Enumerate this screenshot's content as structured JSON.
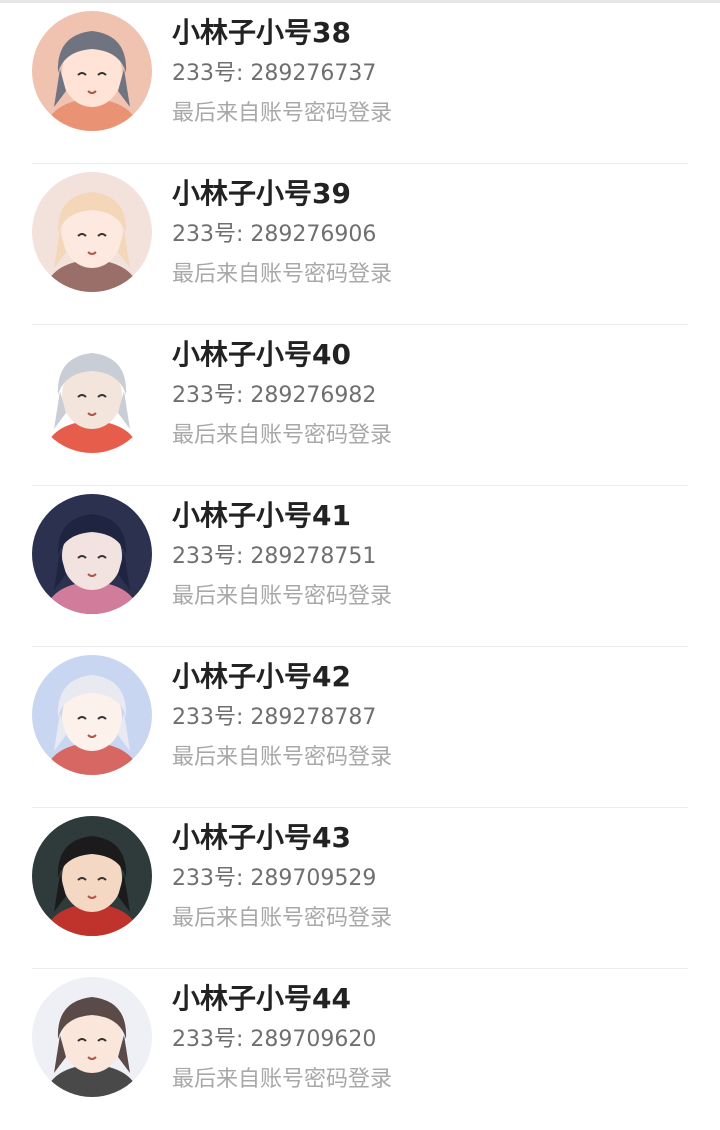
{
  "accounts": [
    {
      "name": "小林子小号38",
      "uid_label": "233号: 289276737",
      "login_source": "最后来自账号密码登录",
      "avatar_icon": "anime-girl-avatar",
      "colors": {
        "bg": "#f0c2b0",
        "hair": "#6f7480",
        "skin": "#ffe3d6",
        "accent": "#e88a6a"
      }
    },
    {
      "name": "小林子小号39",
      "uid_label": "233号: 289276906",
      "login_source": "最后来自账号密码登录",
      "avatar_icon": "anime-boy-avatar",
      "colors": {
        "bg": "#f3e2dc",
        "hair": "#f4d6b8",
        "skin": "#fde9df",
        "accent": "#8a5a56"
      }
    },
    {
      "name": "小林子小号40",
      "uid_label": "233号: 289276982",
      "login_source": "最后来自账号密码登录",
      "avatar_icon": "firefighter-avatar",
      "colors": {
        "bg": "#ffffff",
        "hair": "#c9ced6",
        "skin": "#f3e5dc",
        "accent": "#e2412b"
      }
    },
    {
      "name": "小林子小号41",
      "uid_label": "233号: 289278751",
      "login_source": "最后来自账号密码登录",
      "avatar_icon": "anime-boy-avatar",
      "colors": {
        "bg": "#2c3150",
        "hair": "#1f2540",
        "skin": "#f2e2e0",
        "accent": "#f08aa8"
      }
    },
    {
      "name": "小林子小号42",
      "uid_label": "233号: 289278787",
      "login_source": "最后来自账号密码登录",
      "avatar_icon": "anime-boy-avatar",
      "colors": {
        "bg": "#c9d6f2",
        "hair": "#e9e9f2",
        "skin": "#fdf1ec",
        "accent": "#d9534a"
      }
    },
    {
      "name": "小林子小号43",
      "uid_label": "233号: 289709529",
      "login_source": "最后来自账号密码登录",
      "avatar_icon": "noodle-cup-avatar",
      "colors": {
        "bg": "#2f3a3a",
        "hair": "#1b1b1b",
        "skin": "#f4d8c4",
        "accent": "#d9322c"
      }
    },
    {
      "name": "小林子小号44",
      "uid_label": "233号: 289709620",
      "login_source": "最后来自账号密码登录",
      "avatar_icon": "anime-girl-avatar",
      "colors": {
        "bg": "#eef0f6",
        "hair": "#5a4a48",
        "skin": "#fbe6db",
        "accent": "#2b2b2b"
      }
    }
  ]
}
